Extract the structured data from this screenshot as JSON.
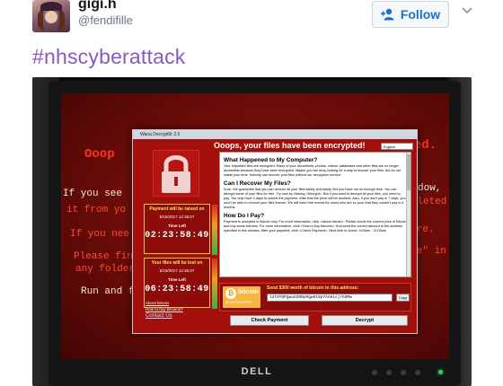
{
  "tweet": {
    "display_name": "gigi.h",
    "screen_name": "@fendifille",
    "follow_label": "Follow",
    "hashtag": "#nhscyberattack",
    "colors": {
      "follow_text": "#1d70c9",
      "hashtag": "#8a58c0"
    }
  },
  "photo": {
    "background_text": [
      "Ooop",
      "cted.",
      "If you see",
      "\" window,",
      "u deleted",
      "it from yo",
      "If you nee",
      "tware.",
      "Please fin",
      ".exe\" in",
      "any folder",
      "Run and fo"
    ],
    "monitor_brand": "DELL",
    "ransom_window": {
      "title": "Wana Decrypt0r 2.0",
      "heading": "Ooops, your files have been encrypted!",
      "language": "English",
      "timer_raise": {
        "title": "Payment will be raised on",
        "date": "5/15/2017 12:36:07",
        "left_label": "Time Left",
        "time": "02:23:58:49"
      },
      "timer_lost": {
        "title": "Your files will be lost on",
        "date": "5/19/2017 12:36:07",
        "left_label": "Time Left",
        "time": "06:23:58:49"
      },
      "links": [
        "About bitcoin",
        "How to buy bitcoins?",
        "Contact Us"
      ],
      "sections": [
        {
          "heading": "What Happened to My Computer?",
          "body": "Your important files are encrypted. Many of your documents, photos, videos, databases and other files are no longer accessible because they have been encrypted. Maybe you are busy looking for a way to recover your files, but do not waste your time. Nobody can recover your files without our decryption service."
        },
        {
          "heading": "Can I Recover My Files?",
          "body": "Sure. We guarantee that you can recover all your files safely and easily. But you have not so enough time. You can decrypt some of your files for free. Try now by clicking <Decrypt>. But if you want to decrypt all your files, you need to pay. You only have 3 days to submit the payment. After that the price will be doubled. Also, if you don't pay in 7 days, you won't be able to recover your files forever. We will have free events for users who are so poor that they couldn't pay in 6 months."
        },
        {
          "heading": "How Do I Pay?",
          "body": "Payment is accepted in Bitcoin only. For more information, click <About bitcoin>. Please check the current price of Bitcoin and buy some bitcoins. For more information, click <How to buy bitcoins>. And send the correct amount to the address specified in this window. After your payment, click <Check Payment>. Best time to check: 9:00am - 11:00am"
        }
      ],
      "bitcoin": {
        "logo_word": "bitcoin",
        "accepted": "ACCEPTED HERE",
        "send_label": "Send $300 worth of bitcoin to this address:",
        "address": "12t9YDPgwueZ9NyMgw519p7AA8isjr6SMw",
        "copy_label": "Copy"
      },
      "check_payment_label": "Check Payment",
      "decrypt_label": "Decrypt"
    }
  }
}
